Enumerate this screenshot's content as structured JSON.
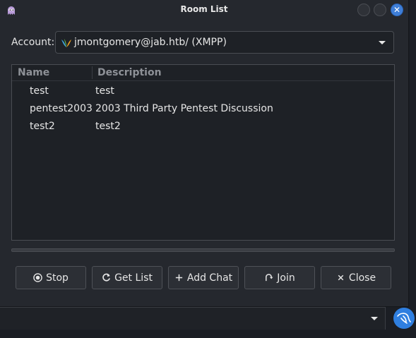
{
  "window": {
    "title": "Room List"
  },
  "account": {
    "label": "Account:",
    "value": "jmontgomery@jab.htb/ (XMPP)"
  },
  "room_list": {
    "columns": [
      "Name",
      "Description"
    ],
    "rows": [
      {
        "name": "test",
        "description": "test"
      },
      {
        "name": "pentest2003",
        "description": "2003 Third Party Pentest Discussion"
      },
      {
        "name": "test2",
        "description": "test2"
      }
    ]
  },
  "buttons": {
    "stop": "Stop",
    "get_list": "Get List",
    "add_chat": "Add Chat",
    "join": "Join",
    "close": "Close"
  },
  "icons": {
    "app": "pidgin-icon",
    "protocol": "xmpp-icon",
    "menu": "kali-dragon-icon"
  },
  "colors": {
    "accent": "#3f7fd8",
    "background": "#25282e"
  }
}
